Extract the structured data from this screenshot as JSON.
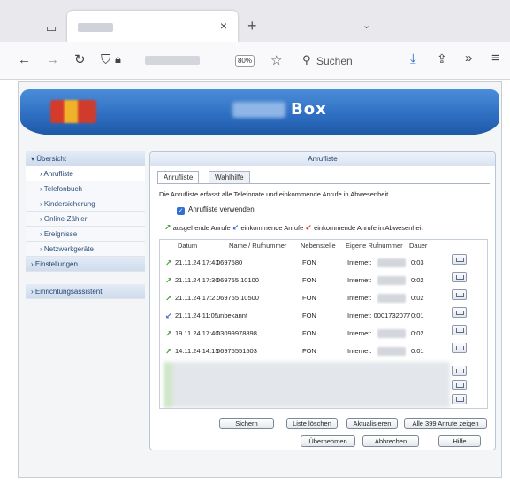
{
  "browser": {
    "tab_title": "",
    "new_tab_symbol": "+",
    "url": "",
    "zoom": "80%",
    "search_placeholder": "Suchen"
  },
  "router": {
    "name_suffix": "Box"
  },
  "sidebar": {
    "items": [
      {
        "label": "▾ Übersicht",
        "level": "top"
      },
      {
        "label": "› Anrufliste",
        "level": "sub",
        "active": true
      },
      {
        "label": "› Telefonbuch",
        "level": "sub"
      },
      {
        "label": "› Kindersicherung",
        "level": "sub"
      },
      {
        "label": "› Online-Zähler",
        "level": "sub"
      },
      {
        "label": "› Ereignisse",
        "level": "sub"
      },
      {
        "label": "› Netzwerkgeräte",
        "level": "sub"
      },
      {
        "label": "› Einstellungen",
        "level": "top"
      },
      {
        "label": "› Einrichtungsassistent",
        "level": "top"
      }
    ]
  },
  "content": {
    "title": "Anrufliste",
    "tabs": [
      "Anrufliste",
      "Wahlhilfe"
    ],
    "description": "Die Anrufliste erfasst alle Telefonate und einkommende Anrufe in Abwesenheit.",
    "checkbox_label": "Anrufliste verwenden",
    "legend": {
      "outgoing": "ausgehende Anrufe",
      "incoming": "einkommende Anrufe",
      "missed": "einkommende Anrufe in Abwesenheit"
    },
    "headers": {
      "date": "Datum",
      "name": "Name / Rufnummer",
      "extension": "Nebenstelle",
      "own_number": "Eigene Rufnummer",
      "duration": "Dauer"
    },
    "calls": [
      {
        "type": "outgoing",
        "date": "21.11.24 17:43",
        "number": "0697580",
        "extension": "FON",
        "own": "Internet:",
        "duration": "0:03"
      },
      {
        "type": "outgoing",
        "date": "21.11.24 17:30",
        "number": "069755 10100",
        "extension": "FON",
        "own": "Internet:",
        "duration": "0:02"
      },
      {
        "type": "outgoing",
        "date": "21.11.24 17:27",
        "number": "069755 10500",
        "extension": "FON",
        "own": "Internet:",
        "duration": "0:02"
      },
      {
        "type": "incoming",
        "date": "21.11.24 11:05",
        "number": "unbekannt",
        "extension": "FON",
        "own": "Internet: 0001732077",
        "duration": "0:01"
      },
      {
        "type": "outgoing",
        "date": "19.11.24 17:40",
        "number": "03099978898",
        "extension": "FON",
        "own": "Internet:",
        "duration": "0:02"
      },
      {
        "type": "outgoing",
        "date": "14.11.24 14:15",
        "number": "06975551503",
        "extension": "FON",
        "own": "Internet:",
        "duration": "0:01"
      }
    ],
    "buttons_row1": [
      "Sichern",
      "Liste löschen",
      "Aktualisieren",
      "Alle 399 Anrufe zeigen"
    ],
    "buttons_row2": [
      "Übernehmen",
      "Abbrechen",
      "Hilfe"
    ]
  },
  "colors": {
    "outgoing": "#3f9a34",
    "incoming": "#3a67c8",
    "missed": "#d23a2c",
    "banner": "#2f6fc2"
  },
  "icons": {
    "outgoing": "phone-outgoing-icon",
    "incoming": "phone-incoming-icon",
    "missed": "phone-missed-icon",
    "phonebook": "phonebook-icon"
  }
}
